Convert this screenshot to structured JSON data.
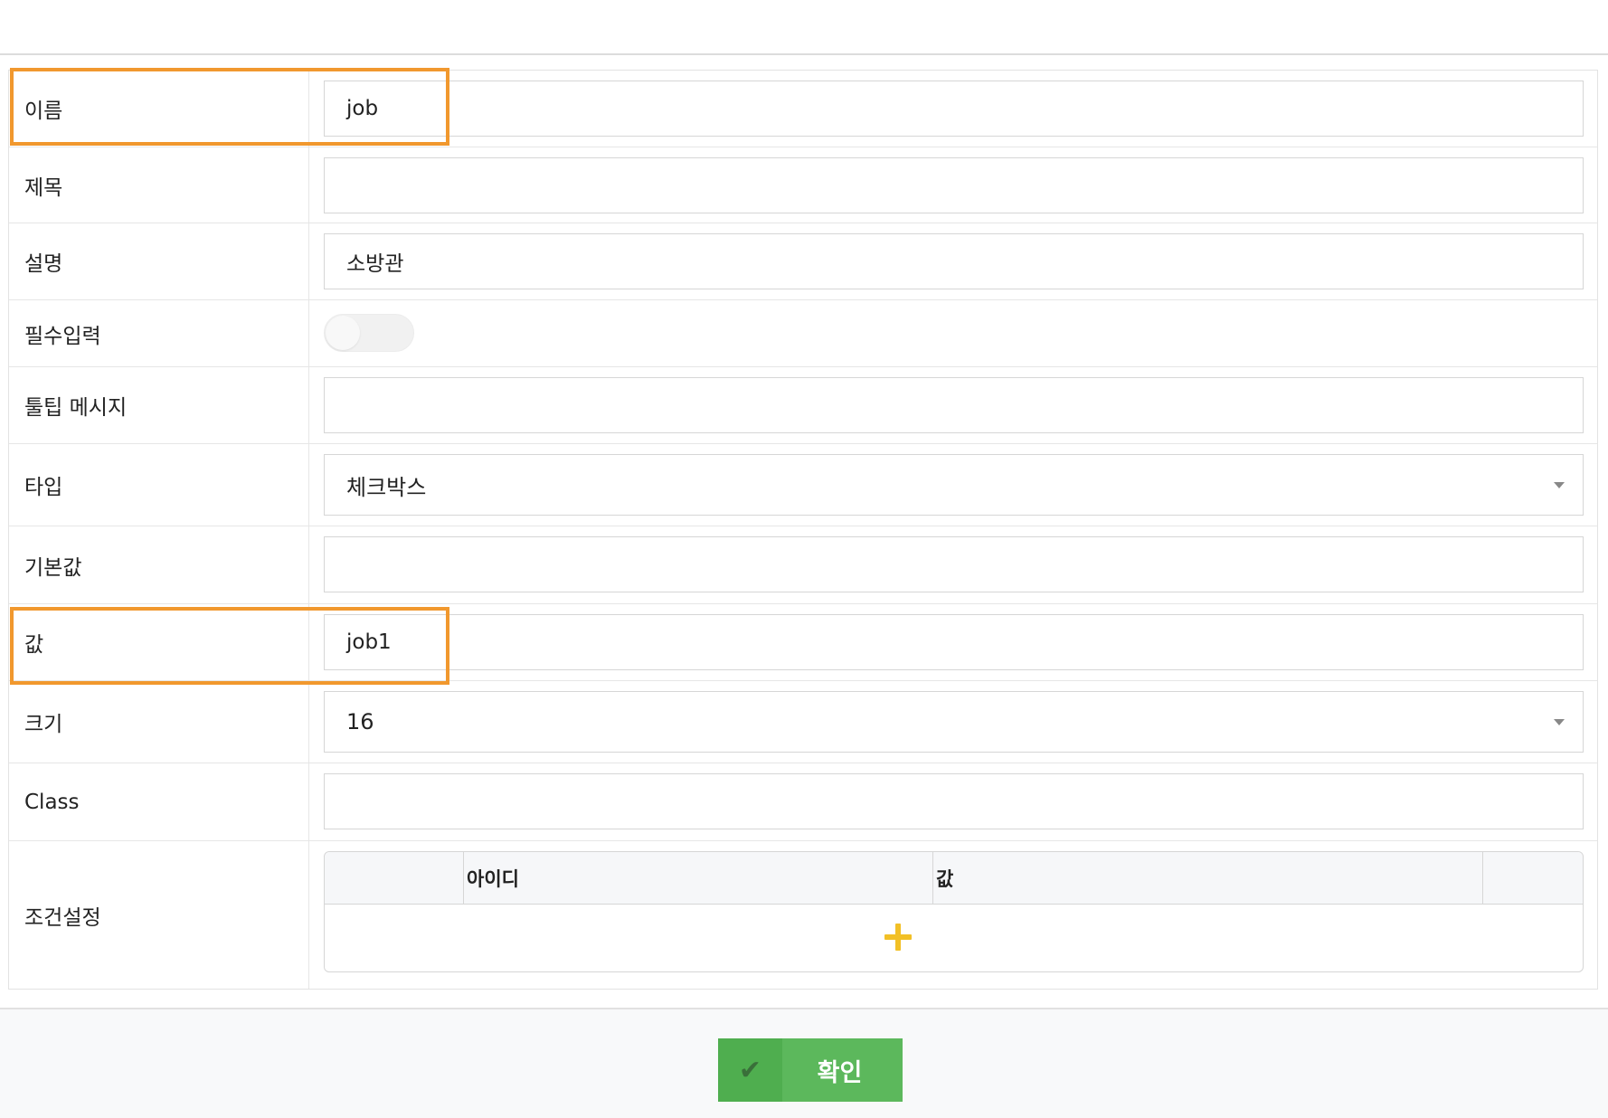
{
  "form": {
    "name": {
      "label": "이름",
      "value": "job"
    },
    "title": {
      "label": "제목",
      "value": ""
    },
    "description": {
      "label": "설명",
      "value": "소방관"
    },
    "required": {
      "label": "필수입력",
      "on": false
    },
    "tooltip": {
      "label": "툴팁 메시지",
      "value": ""
    },
    "type": {
      "label": "타입",
      "value": "체크박스"
    },
    "default_value": {
      "label": "기본값",
      "value": ""
    },
    "value": {
      "label": "값",
      "value": "job1"
    },
    "size": {
      "label": "크기",
      "value": "16"
    },
    "class": {
      "label": "Class",
      "value": ""
    },
    "conditions": {
      "label": "조건설정",
      "columns": [
        "아이디",
        "값"
      ]
    }
  },
  "footer": {
    "confirm_label": "확인"
  },
  "colors": {
    "highlight": "#f1982e",
    "confirm_button": "#5cb85c",
    "add_icon": "#f2c026"
  },
  "icons": {
    "add": "plus-icon",
    "confirm": "check-icon",
    "dropdown": "caret-down-icon"
  }
}
